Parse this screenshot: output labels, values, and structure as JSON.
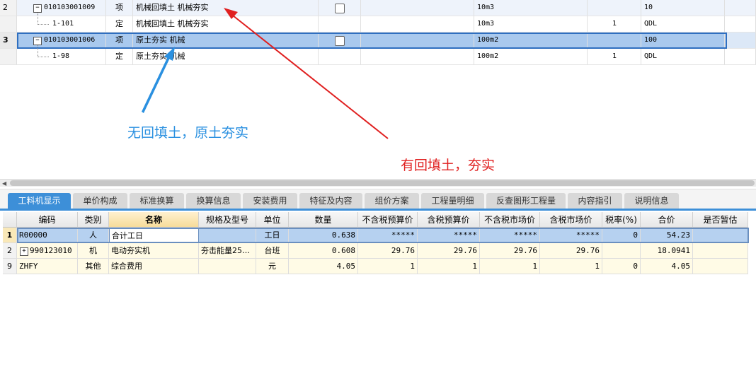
{
  "top_grid": {
    "rows": [
      {
        "num": "2",
        "code": "010103001009",
        "type": "项",
        "name": "机械回填土 机械夯实",
        "unit": "10m3",
        "qty": "",
        "expr": "10",
        "kind": "main"
      },
      {
        "num": "",
        "code": "1-101",
        "type": "定",
        "name": "机械回填土 机械夯实",
        "unit": "10m3",
        "qty": "1",
        "expr": "QDL",
        "kind": "child"
      },
      {
        "num": "3",
        "code": "010103001006",
        "type": "项",
        "name": "原土夯实 机械",
        "unit": "100m2",
        "qty": "",
        "expr": "100",
        "kind": "main"
      },
      {
        "num": "",
        "code": "1-98",
        "type": "定",
        "name": "原土夯实 机械",
        "unit": "100m2",
        "qty": "1",
        "expr": "QDL",
        "kind": "child"
      }
    ],
    "toggle_symbol": "−"
  },
  "annotations": {
    "blue_text": "无回填土，原土夯实",
    "red_text": "有回填土，夯实",
    "blue_color": "#2a90e0",
    "red_color": "#e02020"
  },
  "tabs": [
    {
      "label": "工料机显示",
      "active": true
    },
    {
      "label": "单价构成",
      "active": false
    },
    {
      "label": "标准换算",
      "active": false
    },
    {
      "label": "换算信息",
      "active": false
    },
    {
      "label": "安装费用",
      "active": false
    },
    {
      "label": "特征及内容",
      "active": false
    },
    {
      "label": "组价方案",
      "active": false
    },
    {
      "label": "工程量明细",
      "active": false
    },
    {
      "label": "反查图形工程量",
      "active": false
    },
    {
      "label": "内容指引",
      "active": false
    },
    {
      "label": "说明信息",
      "active": false
    }
  ],
  "bottom_grid": {
    "headers": [
      "编码",
      "类别",
      "名称",
      "规格及型号",
      "单位",
      "数量",
      "不含税预算价",
      "含税预算价",
      "不含税市场价",
      "含税市场价",
      "税率(%)",
      "合价",
      "是否暂估"
    ],
    "rows": [
      {
        "num": "1",
        "code": "R00000",
        "cat": "人",
        "name": "合计工日",
        "spec": "",
        "unit": "工日",
        "qty": "0.638",
        "p1": "*****",
        "p2": "*****",
        "p3": "*****",
        "p4": "*****",
        "tax": "0",
        "total": "54.23",
        "est": "",
        "selected": true
      },
      {
        "num": "2",
        "code": "990123010",
        "cat": "机",
        "name": "电动夯实机",
        "spec": "夯击能量25…",
        "unit": "台班",
        "qty": "0.608",
        "p1": "29.76",
        "p2": "29.76",
        "p3": "29.76",
        "p4": "29.76",
        "tax": "",
        "total": "18.0941",
        "est": "",
        "selected": false,
        "expand": "+"
      },
      {
        "num": "9",
        "code": "ZHFY",
        "cat": "其他",
        "name": "综合费用",
        "spec": "",
        "unit": "元",
        "qty": "4.05",
        "p1": "1",
        "p2": "1",
        "p3": "1",
        "p4": "1",
        "tax": "0",
        "total": "4.05",
        "est": "",
        "selected": false
      }
    ]
  }
}
